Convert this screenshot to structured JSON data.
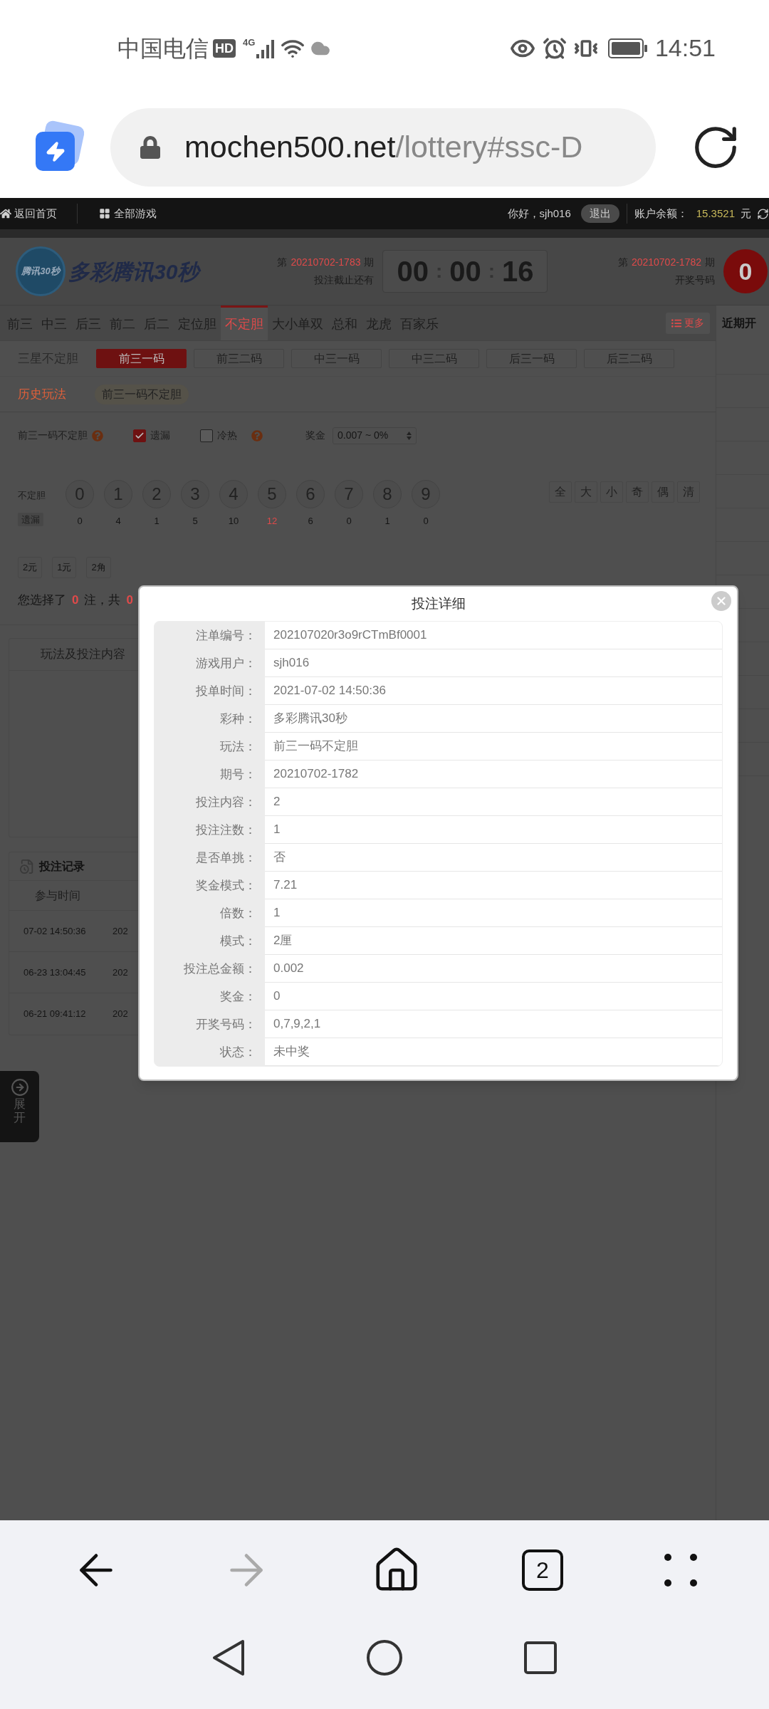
{
  "status_bar": {
    "carrier": "中国电信",
    "hd": "HD",
    "network": "4G",
    "time": "14:51"
  },
  "browser": {
    "url_host": "mochen500.net",
    "url_path": "/lottery#ssc-D"
  },
  "top_bar": {
    "home": "返回首页",
    "all_games": "全部游戏",
    "greeting": "你好，sjh016",
    "logout": "退出",
    "balance_label": "账户余额：",
    "balance": "15.3521",
    "currency": "元"
  },
  "header": {
    "logo_badge": "腾讯30秒",
    "logo_title": "多彩腾讯30秒",
    "current": {
      "prefix": "第",
      "issue": "20210702-1783",
      "suffix": "期",
      "caption": "投注截止还有"
    },
    "countdown": [
      "00",
      ":",
      "00",
      ":",
      "16"
    ],
    "last": {
      "prefix": "第",
      "issue": "20210702-1782",
      "suffix": "期",
      "caption": "开奖号码"
    },
    "last_ball": "0"
  },
  "tabs": [
    {
      "label": "前三",
      "selected": false
    },
    {
      "label": "中三",
      "selected": false
    },
    {
      "label": "后三",
      "selected": false
    },
    {
      "label": "前二",
      "selected": false
    },
    {
      "label": "后二",
      "selected": false
    },
    {
      "label": "定位胆",
      "selected": false
    },
    {
      "label": "不定胆",
      "selected": true
    },
    {
      "label": "大小单双",
      "selected": false
    },
    {
      "label": "总和",
      "selected": false
    },
    {
      "label": "龙虎",
      "selected": false
    },
    {
      "label": "百家乐",
      "selected": false
    }
  ],
  "more": "更多",
  "side_title": "近期开",
  "subtabs": {
    "group_label": "三星不定胆",
    "items": [
      {
        "label": "前三一码",
        "selected": true
      },
      {
        "label": "前三二码",
        "selected": false
      },
      {
        "label": "中三一码",
        "selected": false
      },
      {
        "label": "中三二码",
        "selected": false
      },
      {
        "label": "后三一码",
        "selected": false
      },
      {
        "label": "后三二码",
        "selected": false
      }
    ]
  },
  "history": {
    "label": "历史玩法",
    "items": [
      "前三一码不定胆"
    ]
  },
  "options": {
    "play_name": "前三一码不定胆",
    "checkboxes": [
      {
        "label": "遗漏",
        "checked": true
      },
      {
        "label": "冷热",
        "checked": false
      }
    ],
    "prize_label": "奖金",
    "prize_value": "0.007 ~ 0%"
  },
  "numbers": {
    "row_label": "不定胆",
    "miss_label": "遗漏",
    "balls": [
      {
        "digit": "0",
        "miss": "0",
        "hot": false
      },
      {
        "digit": "1",
        "miss": "4",
        "hot": false
      },
      {
        "digit": "2",
        "miss": "1",
        "hot": false
      },
      {
        "digit": "3",
        "miss": "5",
        "hot": false
      },
      {
        "digit": "4",
        "miss": "10",
        "hot": false
      },
      {
        "digit": "5",
        "miss": "12",
        "hot": true
      },
      {
        "digit": "6",
        "miss": "6",
        "hot": false
      },
      {
        "digit": "7",
        "miss": "0",
        "hot": false
      },
      {
        "digit": "8",
        "miss": "1",
        "hot": false
      },
      {
        "digit": "9",
        "miss": "0",
        "hot": false
      }
    ],
    "quick": [
      "全",
      "大",
      "小",
      "奇",
      "偶",
      "清"
    ]
  },
  "units": [
    "2元",
    "1元",
    "2角"
  ],
  "summary": {
    "prefix": "您选择了",
    "count": "0",
    "middle": "注，共",
    "total": "0"
  },
  "content_table": {
    "header": "玩法及投注内容"
  },
  "records": {
    "title": "投注记录",
    "column": "参与时间",
    "rows": [
      {
        "time": "07-02 14:50:36",
        "issue": "202"
      },
      {
        "time": "06-23 13:04:45",
        "issue": "202"
      },
      {
        "time": "06-21 09:41:12",
        "issue": "202"
      }
    ]
  },
  "expand": "展开",
  "modal": {
    "title": "投注详细",
    "rows": [
      {
        "label": "注单编号：",
        "value": "202107020r3o9rCTmBf0001"
      },
      {
        "label": "游戏用户：",
        "value": "sjh016"
      },
      {
        "label": "投单时间：",
        "value": "2021-07-02 14:50:36"
      },
      {
        "label": "彩种：",
        "value": "多彩腾讯30秒"
      },
      {
        "label": "玩法：",
        "value": "前三一码不定胆"
      },
      {
        "label": "期号：",
        "value": "20210702-1782"
      },
      {
        "label": "投注内容：",
        "value": "2"
      },
      {
        "label": "投注注数：",
        "value": "1"
      },
      {
        "label": "是否单挑：",
        "value": "否"
      },
      {
        "label": "奖金模式：",
        "value": "7.21"
      },
      {
        "label": "倍数：",
        "value": "1"
      },
      {
        "label": "模式：",
        "value": "2厘"
      },
      {
        "label": "投注总金额：",
        "value": "0.002"
      },
      {
        "label": "奖金：",
        "value": "0"
      },
      {
        "label": "开奖号码：",
        "value": "0,7,9,2,1"
      },
      {
        "label": "状态：",
        "value": "未中奖"
      }
    ]
  },
  "nav": {
    "tab_count": "2"
  }
}
